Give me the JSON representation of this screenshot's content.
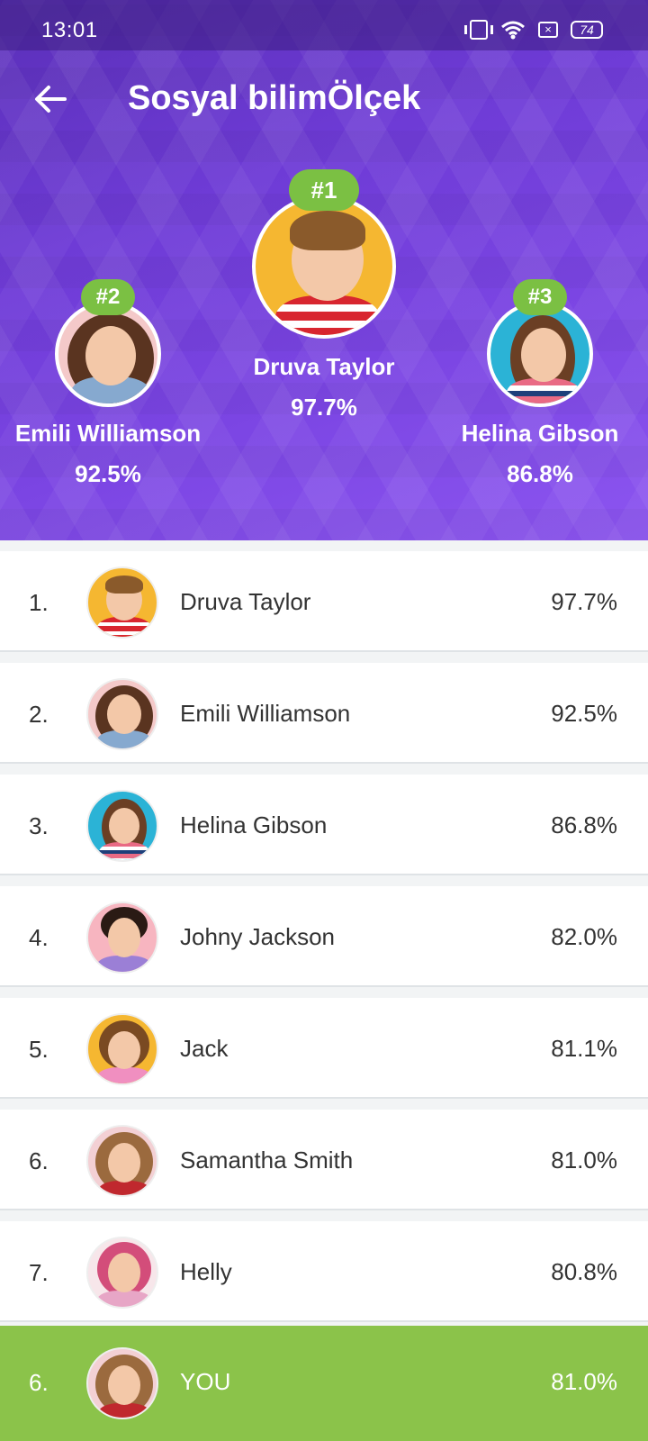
{
  "status_bar": {
    "time": "13:01",
    "battery": "74",
    "icons": [
      "vibrate-icon",
      "wifi-icon",
      "close-box-icon",
      "battery-icon"
    ]
  },
  "header": {
    "title": "Sosyal bilimÖlçek",
    "back_icon": "arrow-left-icon"
  },
  "podium": [
    {
      "rank_label": "#1",
      "name": "Druva Taylor",
      "score": "97.7%"
    },
    {
      "rank_label": "#2",
      "name": "Emili Williamson",
      "score": "92.5%"
    },
    {
      "rank_label": "#3",
      "name": "Helina Gibson",
      "score": "86.8%"
    }
  ],
  "leaderboard": [
    {
      "rank": "1.",
      "name": "Druva Taylor",
      "score": "97.7%"
    },
    {
      "rank": "2.",
      "name": "Emili Williamson",
      "score": "92.5%"
    },
    {
      "rank": "3.",
      "name": "Helina Gibson",
      "score": "86.8%"
    },
    {
      "rank": "4.",
      "name": "Johny Jackson",
      "score": "82.0%"
    },
    {
      "rank": "5.",
      "name": "Jack",
      "score": "81.1%"
    },
    {
      "rank": "6.",
      "name": "Samantha Smith",
      "score": "81.0%"
    },
    {
      "rank": "7.",
      "name": "Helly",
      "score": "80.8%"
    }
  ],
  "current_user": {
    "rank": "6.",
    "name": "YOU",
    "score": "81.0%"
  },
  "colors": {
    "header_purple": "#6e3bd6",
    "badge_green": "#7bc043",
    "you_row_green": "#8bc34a",
    "text_dark": "#333333"
  }
}
